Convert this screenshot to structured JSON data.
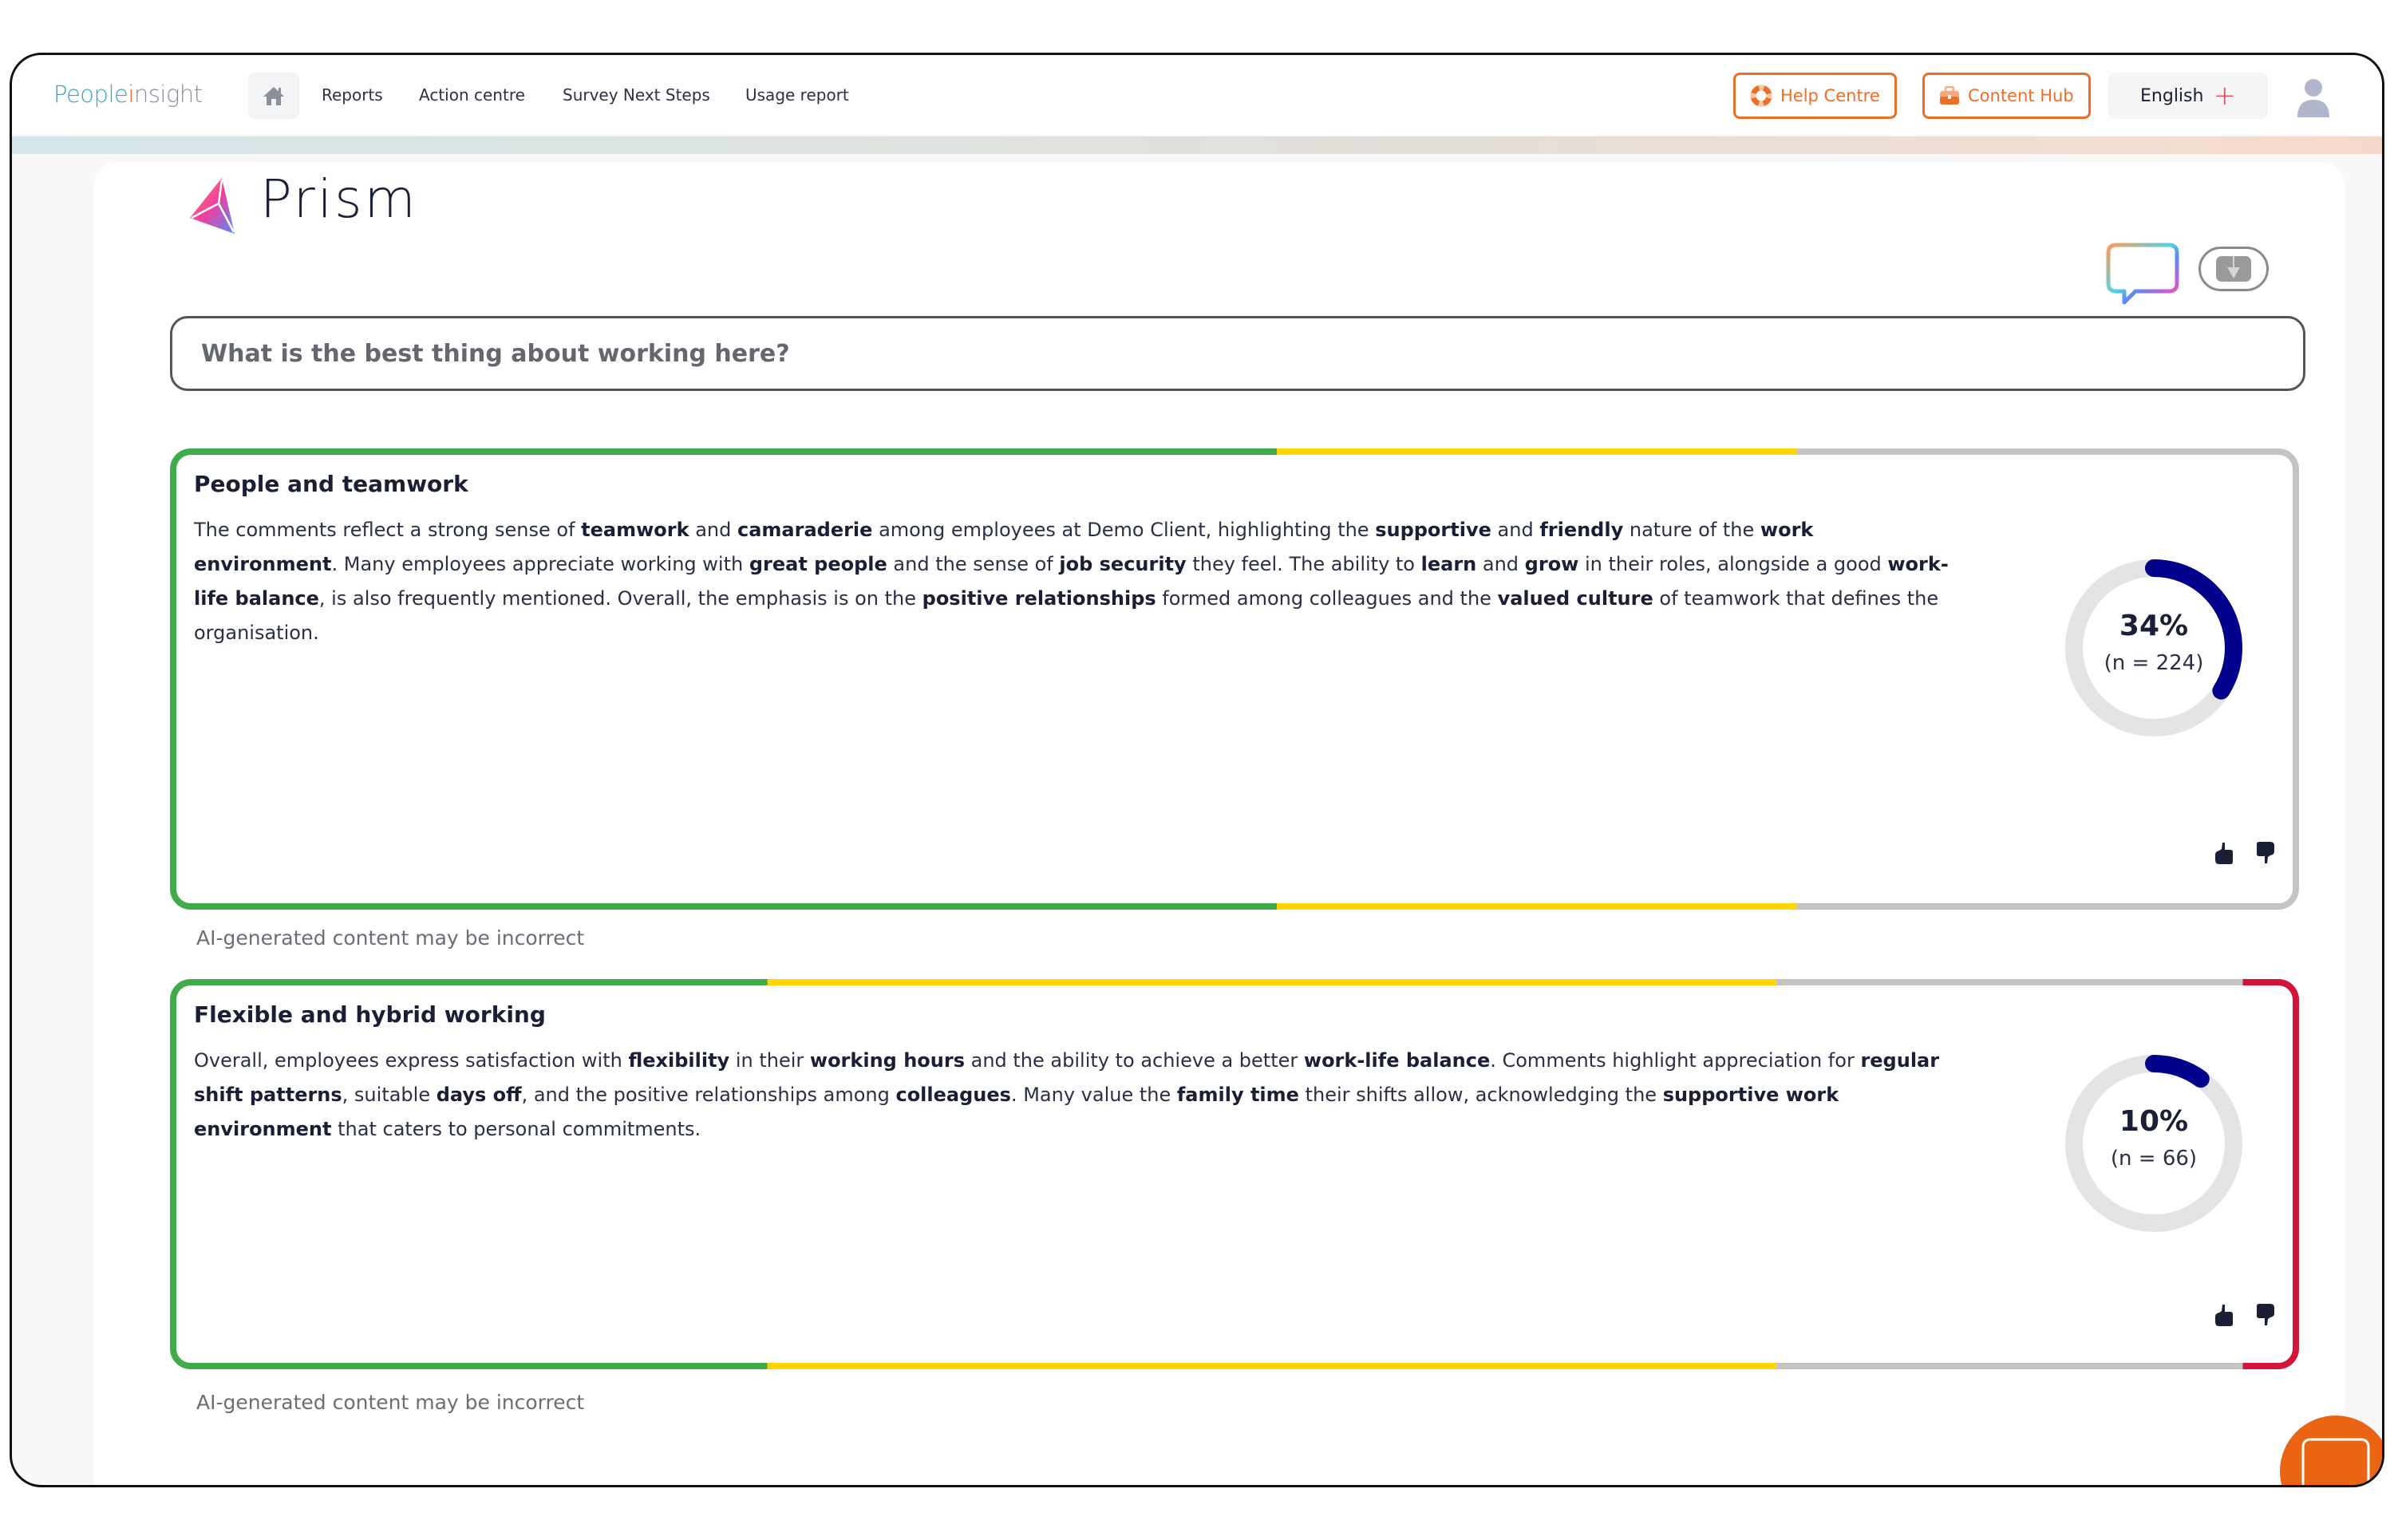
{
  "nav": {
    "logo_prefix": "People",
    "logo_i": "i",
    "logo_suffix": "nsight",
    "home_icon": "home-icon",
    "links": [
      "Reports",
      "Action centre",
      "Survey Next Steps",
      "Usage report"
    ],
    "help_centre_label": "Help Centre",
    "content_hub_label": "Content Hub",
    "language_label": "English",
    "language_icon": "plus-icon",
    "avatar_icon": "user-avatar-icon"
  },
  "prism": {
    "title": "Prism",
    "question": "What is the best thing about working here?"
  },
  "colors": {
    "accent": "#e8702a",
    "positive": "#3fab4b",
    "neutral": "#ffd600",
    "unrated": "#c4c4c4",
    "negative": "#d0143a",
    "donut_fill": "#00008b",
    "donut_track": "#e4e4e4",
    "fab": "#ea6413"
  },
  "themes": [
    {
      "title": "People and teamwork",
      "segments": [
        {
          "label": "positive",
          "share": 0.52
        },
        {
          "label": "neutral",
          "share": 0.245
        },
        {
          "label": "unrated",
          "share": 0.235
        },
        {
          "label": "negative",
          "share": 0
        }
      ],
      "summary": [
        [
          "The comments reflect a strong sense of ",
          false
        ],
        [
          "teamwork",
          true
        ],
        [
          " and ",
          false
        ],
        [
          "camaraderie",
          true
        ],
        [
          " among employees at Demo Client, highlighting the ",
          false
        ],
        [
          "supportive",
          true
        ],
        [
          " and ",
          false
        ],
        [
          "friendly",
          true
        ],
        [
          " nature of the ",
          false
        ],
        [
          "work environment",
          true
        ],
        [
          ". Many employees appreciate working with ",
          false
        ],
        [
          "great people",
          true
        ],
        [
          " and the sense of ",
          false
        ],
        [
          "job security",
          true
        ],
        [
          " they feel. The ability to ",
          false
        ],
        [
          "learn",
          true
        ],
        [
          " and ",
          false
        ],
        [
          "grow",
          true
        ],
        [
          " in their roles, alongside a good ",
          false
        ],
        [
          "work-life balance",
          true
        ],
        [
          ", is also frequently mentioned. Overall, the emphasis is on the ",
          false
        ],
        [
          "positive relationships",
          true
        ],
        [
          " formed among colleagues and the ",
          false
        ],
        [
          "valued culture",
          true
        ],
        [
          " of teamwork that defines the organisation.",
          false
        ]
      ],
      "percent": 34,
      "percent_label": "34%",
      "n_label": "(n = 224)",
      "disclaimer": "AI-generated content may be incorrect"
    },
    {
      "title": "Flexible and hybrid working",
      "segments": [
        {
          "label": "positive",
          "share": 0.28
        },
        {
          "label": "neutral",
          "share": 0.475
        },
        {
          "label": "unrated",
          "share": 0.22
        },
        {
          "label": "negative",
          "share": 0.025
        }
      ],
      "summary": [
        [
          "Overall, employees express satisfaction with ",
          false
        ],
        [
          "flexibility",
          true
        ],
        [
          " in their ",
          false
        ],
        [
          "working hours",
          true
        ],
        [
          " and the ability to achieve a better ",
          false
        ],
        [
          "work-life balance",
          true
        ],
        [
          ". Comments highlight appreciation for ",
          false
        ],
        [
          "regular shift patterns",
          true
        ],
        [
          ", suitable ",
          false
        ],
        [
          "days off",
          true
        ],
        [
          ", and the positive relationships among ",
          false
        ],
        [
          "colleagues",
          true
        ],
        [
          ". Many value the ",
          false
        ],
        [
          "family time",
          true
        ],
        [
          " their shifts allow, acknowledging the ",
          false
        ],
        [
          "supportive work environment",
          true
        ],
        [
          " that caters to personal commitments.",
          false
        ]
      ],
      "percent": 10,
      "percent_label": "10%",
      "n_label": "(n = 66)",
      "disclaimer": "AI-generated content may be incorrect"
    }
  ]
}
